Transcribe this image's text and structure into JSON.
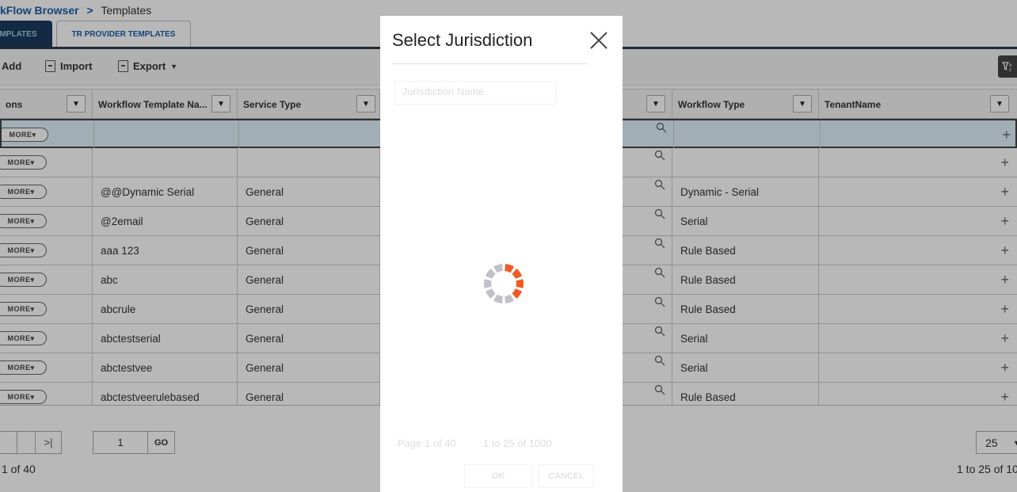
{
  "breadcrumb": {
    "parent": "kFlow Browser",
    "separator": ">",
    "current": "Templates"
  },
  "tabs": {
    "active": "MPLATES",
    "inactive": "TR PROVIDER TEMPLATES"
  },
  "toolbar": {
    "add": "Add",
    "import": "Import",
    "export": "Export"
  },
  "grid": {
    "columns": [
      "ons",
      "Workflow Template Na...",
      "Service Type",
      "Workflow Type",
      "TenantName"
    ],
    "more_label": "MORE",
    "rows": [
      {
        "name": "",
        "service": "",
        "type": ""
      },
      {
        "name": "",
        "service": "",
        "type": ""
      },
      {
        "name": "@@Dynamic Serial",
        "service": "General",
        "type": "Dynamic - Serial"
      },
      {
        "name": "@2email",
        "service": "General",
        "type": "Serial"
      },
      {
        "name": "aaa 123",
        "service": "General",
        "type": "Rule Based"
      },
      {
        "name": "abc",
        "service": "General",
        "type": "Rule Based"
      },
      {
        "name": "abcrule",
        "service": "General",
        "type": "Rule Based"
      },
      {
        "name": "abctestserial",
        "service": "General",
        "type": "Serial"
      },
      {
        "name": "abctestvee",
        "service": "General",
        "type": "Serial"
      },
      {
        "name": "abctestveerulebased",
        "service": "General",
        "type": "Rule Based"
      }
    ]
  },
  "pager": {
    "page_input": "1",
    "go": "GO",
    "page_of": "1 of 40",
    "page_size": "25",
    "range": "1 to 25 of 10"
  },
  "modal": {
    "title": "Select Jurisdiction",
    "field_placeholder": "Jurisdiction Name",
    "page_text": "Page 1 of 40",
    "range_text": "1 to 25 of 1000",
    "ok": "OK",
    "cancel": "CANCEL"
  },
  "colors": {
    "accent": "#f15a22",
    "spinner_gray": "#c0c0c8",
    "brand_link": "#1a5fa8"
  }
}
